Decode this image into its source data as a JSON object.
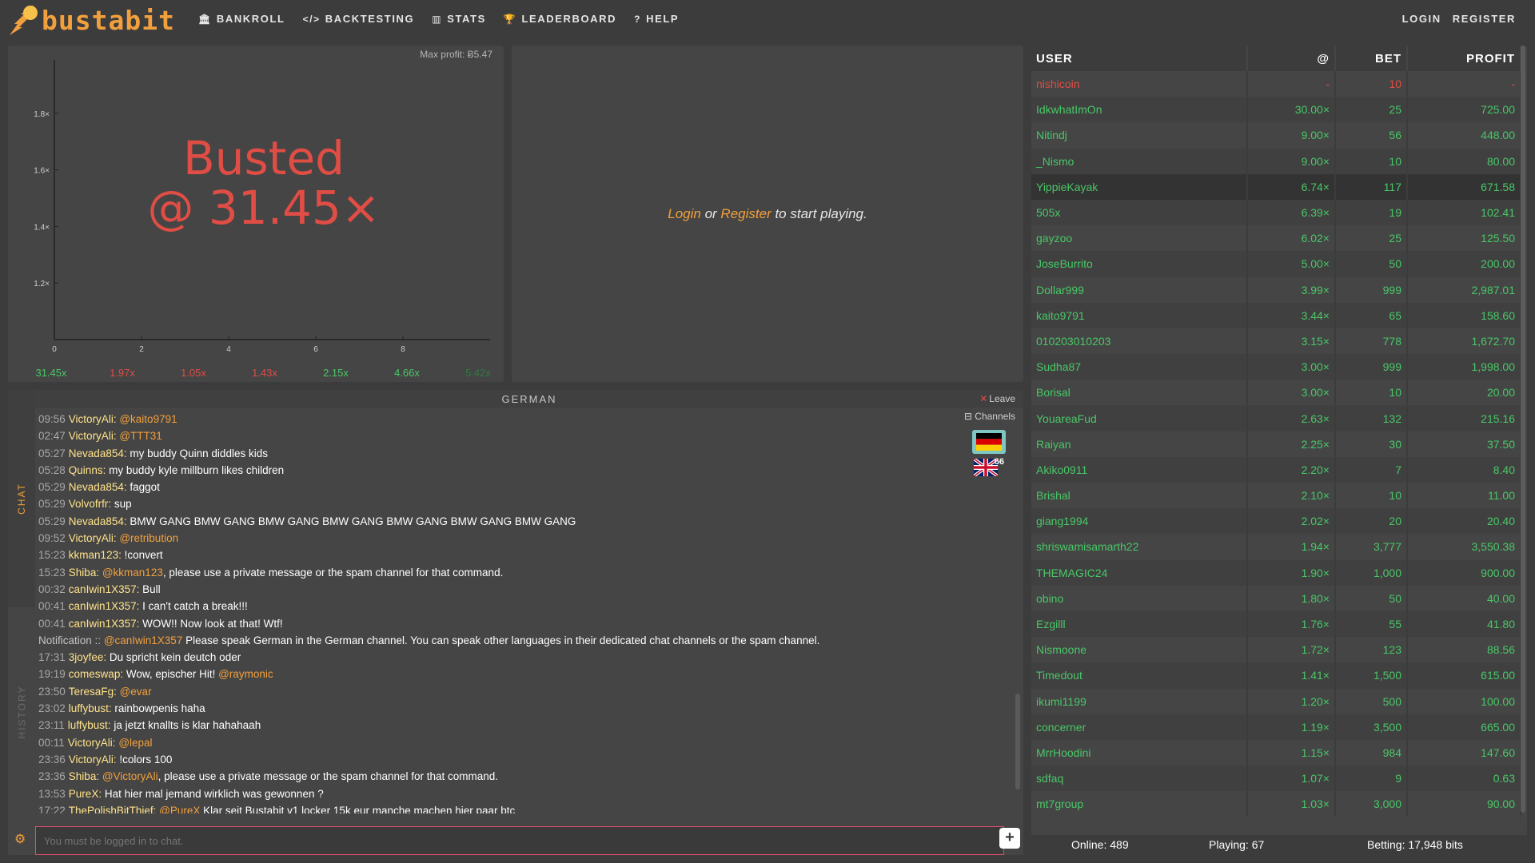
{
  "brand": {
    "name": "bustabit"
  },
  "nav": {
    "items": [
      {
        "label": "BANKROLL",
        "icon": "bank-icon"
      },
      {
        "label": "BACKTESTING",
        "icon": "code-icon"
      },
      {
        "label": "STATS",
        "icon": "chart-icon"
      },
      {
        "label": "LEADERBOARD",
        "icon": "trophy-icon"
      },
      {
        "label": "HELP",
        "icon": "question-icon"
      }
    ],
    "login": "LOGIN",
    "register": "REGISTER"
  },
  "game": {
    "max_profit": "Max profit: Ƀ5.47",
    "busted_line1": "Busted",
    "busted_line2": "@ 31.45×"
  },
  "chart_data": {
    "type": "line",
    "x_ticks": [
      "0",
      "2",
      "4",
      "6",
      "8"
    ],
    "y_ticks": [
      "1.2×",
      "1.4×",
      "1.6×",
      "1.8×"
    ],
    "xlim": [
      0,
      10
    ],
    "ylim": [
      1.0,
      2.0
    ]
  },
  "history": [
    {
      "value": "31.45x",
      "color": "#49c767"
    },
    {
      "value": "1.97x",
      "color": "#e04d45"
    },
    {
      "value": "1.05x",
      "color": "#e04d45"
    },
    {
      "value": "1.43x",
      "color": "#e04d45"
    },
    {
      "value": "2.15x",
      "color": "#49c767"
    },
    {
      "value": "4.66x",
      "color": "#49c767"
    },
    {
      "value": "5.42x",
      "color": "#2f7a44"
    }
  ],
  "bet": {
    "login": "Login",
    "or": " or ",
    "register": "Register",
    "suffix": " to start playing."
  },
  "chat": {
    "tab_chat": "CHAT",
    "tab_history": "HISTORY",
    "channel": "GERMAN",
    "leave": "Leave",
    "channels": "Channels",
    "uk_count": "66",
    "placeholder": "You must be logged in to chat.",
    "messages": [
      {
        "time": "09:56",
        "user": "VictoryAli:",
        "mention": "@kaito9791",
        "text": ""
      },
      {
        "time": "02:47",
        "user": "VictoryAli:",
        "mention": "@TTT31",
        "text": ""
      },
      {
        "time": "05:27",
        "user": "Nevada854:",
        "mention": "",
        "text": "my buddy Quinn diddles kids"
      },
      {
        "time": "05:28",
        "user": "Quinns:",
        "mention": "",
        "text": "my buddy kyle millburn likes children"
      },
      {
        "time": "05:29",
        "user": "Nevada854:",
        "mention": "",
        "text": "faggot"
      },
      {
        "time": "05:29",
        "user": "Volvofrfr:",
        "mention": "",
        "text": "sup"
      },
      {
        "time": "05:29",
        "user": "Nevada854:",
        "mention": "",
        "text": "BMW GANG BMW GANG BMW GANG BMW GANG BMW GANG BMW GANG BMW GANG"
      },
      {
        "time": "09:52",
        "user": "VictoryAli:",
        "mention": "@retribution",
        "text": ""
      },
      {
        "time": "15:23",
        "user": "kkman123:",
        "mention": "",
        "text": "!convert"
      },
      {
        "time": "15:23",
        "user": "Shiba:",
        "mention": "@kkman123",
        "text": ", please use a private message or the spam channel for that command."
      },
      {
        "time": "00:32",
        "user": "canIwin1X357:",
        "mention": "",
        "text": "Bull"
      },
      {
        "time": "00:41",
        "user": "canIwin1X357:",
        "mention": "",
        "text": "I can't catch a break!!!"
      },
      {
        "time": "00:41",
        "user": "canIwin1X357:",
        "mention": "",
        "text": "WOW!! Now look at that! Wtf!"
      },
      {
        "notification": "Notification ::",
        "mention": "@canIwin1X357",
        "text": " Please speak German in the German channel. You can speak other languages in their dedicated chat channels or the spam channel."
      },
      {
        "time": "17:31",
        "user": "3joyfee:",
        "mention": "",
        "text": "Du spricht kein deutch oder"
      },
      {
        "time": "19:19",
        "user": "comeswap:",
        "mention": "",
        "text": "Wow, epischer Hit!",
        "mention2": "@raymonic"
      },
      {
        "time": "23:50",
        "user": "TeresaFg:",
        "mention": "@evar",
        "text": ""
      },
      {
        "time": "23:02",
        "user": "luffybust:",
        "mention": "",
        "text": "rainbowpenis haha"
      },
      {
        "time": "23:11",
        "user": "luffybust:",
        "mention": "",
        "text": "ja jetzt knallts is klar hahahaah"
      },
      {
        "time": "00:11",
        "user": "VictoryAli:",
        "mention": "@lepal",
        "text": ""
      },
      {
        "time": "23:36",
        "user": "VictoryAli:",
        "mention": "",
        "text": "!colors 100"
      },
      {
        "time": "23:36",
        "user": "Shiba:",
        "mention": "@VictoryAli",
        "text": ", please use a private message or the spam channel for that command."
      },
      {
        "time": "13:53",
        "user": "PureX:",
        "mention": "",
        "text": "Hat hier mal jemand wirklich was gewonnen ?"
      },
      {
        "time": "17:22",
        "user": "ThePolishBitThief:",
        "mention": "@PureX",
        "text": " Klar seit Bustabit v1 locker 15k eur manche machen hier paar btc"
      }
    ]
  },
  "players": {
    "headers": {
      "user": "USER",
      "at": "@",
      "bet": "BET",
      "profit": "PROFIT"
    },
    "rows": [
      {
        "user": "nishicoin",
        "at": "-",
        "bet": "10",
        "profit": "-",
        "status": "red"
      },
      {
        "user": "IdkwhatImOn",
        "at": "30.00×",
        "bet": "25",
        "profit": "725.00",
        "status": "green"
      },
      {
        "user": "Nitindj",
        "at": "9.00×",
        "bet": "56",
        "profit": "448.00",
        "status": "green"
      },
      {
        "user": "_Nismo",
        "at": "9.00×",
        "bet": "10",
        "profit": "80.00",
        "status": "green"
      },
      {
        "user": "YippieKayak",
        "at": "6.74×",
        "bet": "117",
        "profit": "671.58",
        "status": "green",
        "highlight": true
      },
      {
        "user": "505x",
        "at": "6.39×",
        "bet": "19",
        "profit": "102.41",
        "status": "green"
      },
      {
        "user": "gayzoo",
        "at": "6.02×",
        "bet": "25",
        "profit": "125.50",
        "status": "green"
      },
      {
        "user": "JoseBurrito",
        "at": "5.00×",
        "bet": "50",
        "profit": "200.00",
        "status": "green"
      },
      {
        "user": "Dollar999",
        "at": "3.99×",
        "bet": "999",
        "profit": "2,987.01",
        "status": "green"
      },
      {
        "user": "kaito9791",
        "at": "3.44×",
        "bet": "65",
        "profit": "158.60",
        "status": "green"
      },
      {
        "user": "010203010203",
        "at": "3.15×",
        "bet": "778",
        "profit": "1,672.70",
        "status": "green"
      },
      {
        "user": "Sudha87",
        "at": "3.00×",
        "bet": "999",
        "profit": "1,998.00",
        "status": "green"
      },
      {
        "user": "Borisal",
        "at": "3.00×",
        "bet": "10",
        "profit": "20.00",
        "status": "green"
      },
      {
        "user": "YouareaFud",
        "at": "2.63×",
        "bet": "132",
        "profit": "215.16",
        "status": "green"
      },
      {
        "user": "Raiyan",
        "at": "2.25×",
        "bet": "30",
        "profit": "37.50",
        "status": "green"
      },
      {
        "user": "Akiko0911",
        "at": "2.20×",
        "bet": "7",
        "profit": "8.40",
        "status": "green"
      },
      {
        "user": "Brishal",
        "at": "2.10×",
        "bet": "10",
        "profit": "11.00",
        "status": "green"
      },
      {
        "user": "giang1994",
        "at": "2.02×",
        "bet": "20",
        "profit": "20.40",
        "status": "green"
      },
      {
        "user": "shriswamisamarth22",
        "at": "1.94×",
        "bet": "3,777",
        "profit": "3,550.38",
        "status": "green"
      },
      {
        "user": "THEMAGIC24",
        "at": "1.90×",
        "bet": "1,000",
        "profit": "900.00",
        "status": "green"
      },
      {
        "user": "obino",
        "at": "1.80×",
        "bet": "50",
        "profit": "40.00",
        "status": "green"
      },
      {
        "user": "Ezgilll",
        "at": "1.76×",
        "bet": "55",
        "profit": "41.80",
        "status": "green"
      },
      {
        "user": "Nismoone",
        "at": "1.72×",
        "bet": "123",
        "profit": "88.56",
        "status": "green"
      },
      {
        "user": "Timedout",
        "at": "1.41×",
        "bet": "1,500",
        "profit": "615.00",
        "status": "green"
      },
      {
        "user": "ikumi1199",
        "at": "1.20×",
        "bet": "500",
        "profit": "100.00",
        "status": "green"
      },
      {
        "user": "concerner",
        "at": "1.19×",
        "bet": "3,500",
        "profit": "665.00",
        "status": "green"
      },
      {
        "user": "MrrHoodini",
        "at": "1.15×",
        "bet": "984",
        "profit": "147.60",
        "status": "green"
      },
      {
        "user": "sdfaq",
        "at": "1.07×",
        "bet": "9",
        "profit": "0.63",
        "status": "green"
      },
      {
        "user": "mt7group",
        "at": "1.03×",
        "bet": "3,000",
        "profit": "90.00",
        "status": "green"
      }
    ],
    "footer": {
      "online": "Online: 489",
      "playing": "Playing: 67",
      "betting": "Betting: 17,948 bits"
    }
  }
}
